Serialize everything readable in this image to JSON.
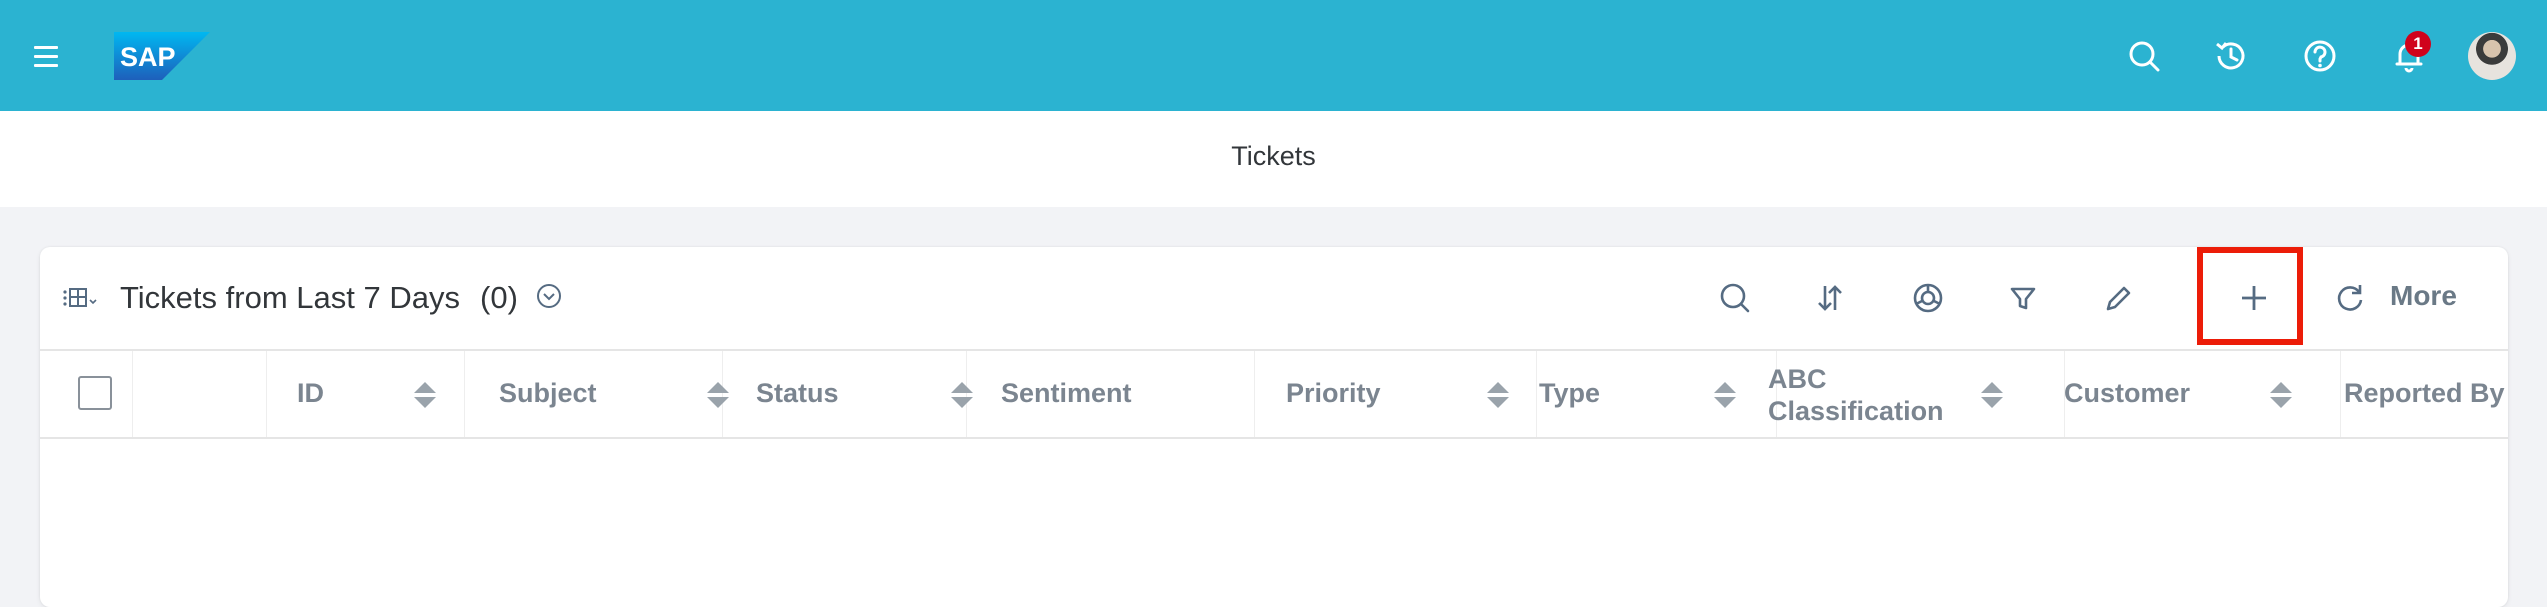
{
  "shell": {
    "logo_text": "SAP",
    "notification_count": "1"
  },
  "page": {
    "title": "Tickets"
  },
  "table": {
    "title": "Tickets from Last 7 Days",
    "count": "(0)",
    "more_label": "More",
    "columns": [
      {
        "label": "ID",
        "sortable": true
      },
      {
        "label": "Subject",
        "sortable": true
      },
      {
        "label": "Status",
        "sortable": true
      },
      {
        "label": "Sentiment",
        "sortable": false
      },
      {
        "label": "Priority",
        "sortable": true
      },
      {
        "label": "Type",
        "sortable": true
      },
      {
        "label": "ABC Classification",
        "sortable": true
      },
      {
        "label": "Customer",
        "sortable": true
      },
      {
        "label": "Reported By",
        "sortable": false
      }
    ]
  },
  "colors": {
    "shellbar": "#2bb3d1",
    "highlight": "#ec1c08",
    "badge": "#d0021b"
  }
}
